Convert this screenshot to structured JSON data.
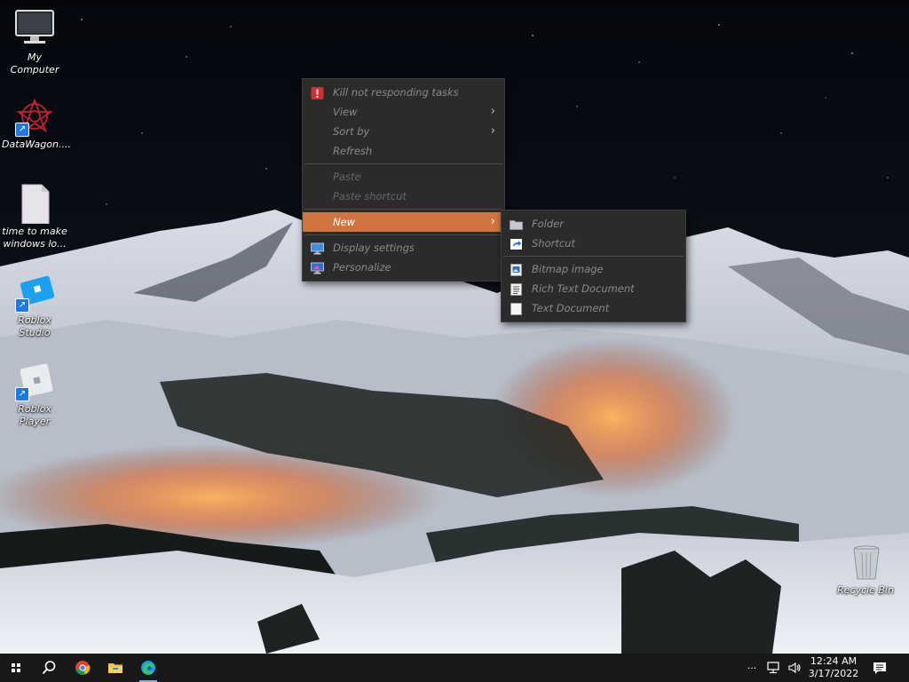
{
  "desktop": {
    "icons": [
      {
        "label": "My Computer",
        "icon": "computer-icon"
      },
      {
        "label": "DataWagon....",
        "icon": "datawagon-icon"
      },
      {
        "label": "time to make windows lo...",
        "icon": "blank-file-icon"
      },
      {
        "label": "Roblox Studio",
        "icon": "roblox-studio-icon"
      },
      {
        "label": "Roblox Player",
        "icon": "roblox-player-icon"
      },
      {
        "label": "Recycle Bin",
        "icon": "recycle-bin-icon"
      }
    ]
  },
  "context_menu": {
    "items": [
      {
        "label": "Kill not responding tasks",
        "icon": "error-icon"
      },
      {
        "label": "View",
        "submenu": true
      },
      {
        "label": "Sort by",
        "submenu": true
      },
      {
        "label": "Refresh"
      },
      {
        "label": "Paste"
      },
      {
        "label": "Paste shortcut"
      },
      {
        "label": "New",
        "submenu": true,
        "active": true
      },
      {
        "label": "Display settings",
        "icon": "display-icon"
      },
      {
        "label": "Personalize",
        "icon": "personalize-icon"
      }
    ]
  },
  "new_submenu": {
    "items": [
      {
        "label": "Folder",
        "icon": "folder-icon"
      },
      {
        "label": "Shortcut",
        "icon": "shortcut-icon"
      },
      {
        "label": "Bitmap image",
        "icon": "bitmap-icon"
      },
      {
        "label": "Rich Text Document",
        "icon": "rich-text-icon"
      },
      {
        "label": "Text Document",
        "icon": "text-document-icon"
      }
    ]
  },
  "taskbar": {
    "time": "12:24 AM",
    "date": "3/17/2022",
    "overflow": "···"
  },
  "colors": {
    "menu_bg": "#2b2b2b",
    "menu_active": "#d2743f",
    "menu_text_disabled": "#8a8a8a",
    "taskbar_bg": "#181818"
  }
}
